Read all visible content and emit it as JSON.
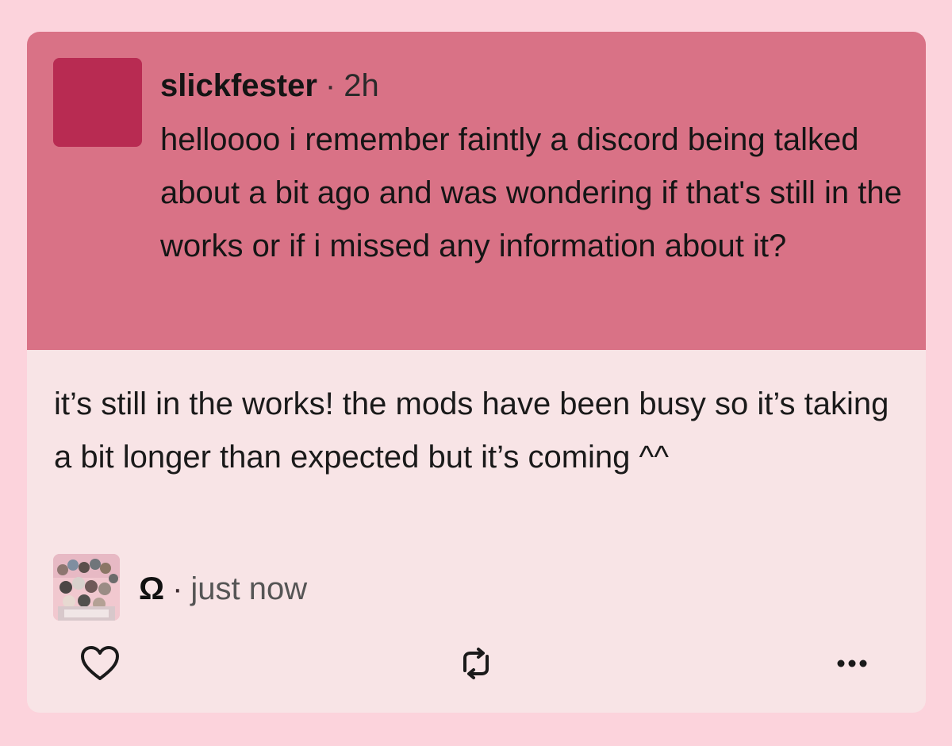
{
  "theme": {
    "page_background": "#fcd3dc",
    "ask_background": "#d97286",
    "answer_background": "#f8e4e6",
    "asker_avatar_color": "#b82b52"
  },
  "ask": {
    "username": "slickfester",
    "separator": "·",
    "time": "2h",
    "text": "helloooo i remember faintly a discord being talked about a bit ago and was wondering if that's still in the works or if i missed any information about it?"
  },
  "answer": {
    "text": "it’s still in the works! the mods have been busy so it’s taking a bit longer than expected but it’s coming ^^",
    "username": "Ω",
    "separator": "·",
    "time": "just now"
  },
  "actions": {
    "like_icon": "heart-icon",
    "reblog_icon": "reblog-icon",
    "more_icon": "more-dots-icon"
  }
}
